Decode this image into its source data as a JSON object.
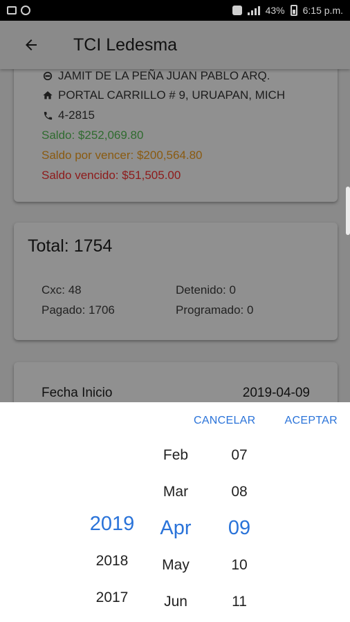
{
  "status_bar": {
    "battery": "43%",
    "time": "6:15 p.m."
  },
  "app_bar": {
    "title": "TCI Ledesma"
  },
  "info_card": {
    "name": "JAMIT DE LA PEÑA JUAN PABLO ARQ.",
    "address": "PORTAL CARRILLO # 9, URUAPAN, MICH",
    "phone": "4-2815",
    "saldo": "Saldo: $252,069.80",
    "saldo_por_vencer": "Saldo por vencer: $200,564.80",
    "saldo_vencido": "Saldo vencido: $51,505.00"
  },
  "total_card": {
    "title": "Total: 1754",
    "cxc": "Cxc: 48",
    "detenido": "Detenido: 0",
    "pagado": "Pagado: 1706",
    "programado": "Programado: 0"
  },
  "fecha_card": {
    "label": "Fecha Inicio",
    "value": "2019-04-09"
  },
  "picker": {
    "cancel_label": "CANCELAR",
    "accept_label": "ACEPTAR",
    "years": [
      "2019",
      "2018",
      "2017"
    ],
    "months": [
      "Feb",
      "Mar",
      "Apr",
      "May",
      "Jun"
    ],
    "days": [
      "07",
      "08",
      "09",
      "10",
      "11"
    ],
    "selected": {
      "year": "2019",
      "month": "Apr",
      "day": "09"
    }
  },
  "colors": {
    "accent": "#2a73d9",
    "saldo": "#2f6b2f",
    "saldo_por_vencer": "#8a5a10",
    "saldo_vencido": "#8e1a1a"
  },
  "icons": {
    "back": "arrow-back-icon",
    "person": "person-icon",
    "home": "home-icon",
    "phone": "phone-icon"
  }
}
